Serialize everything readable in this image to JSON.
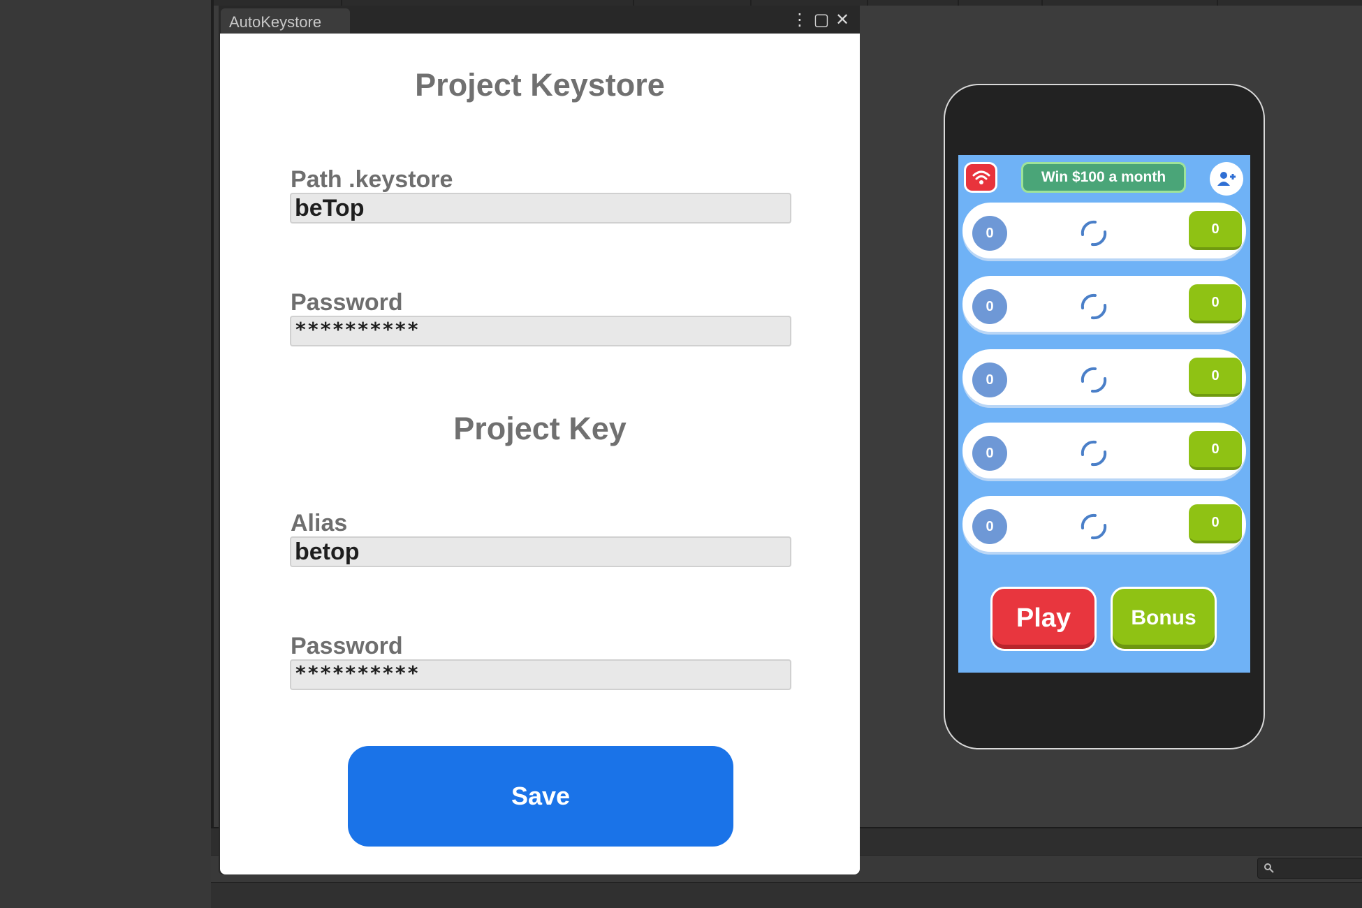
{
  "window": {
    "tab_title": "AutoKeystore",
    "controls": {
      "menu": "⋮",
      "maximize": "▢",
      "close": "✕"
    }
  },
  "keystore_section": {
    "title": "Project Keystore",
    "path_label": "Path .keystore",
    "path_value": "beTop",
    "password_label": "Password",
    "password_value": "**********"
  },
  "key_section": {
    "title": "Project Key",
    "alias_label": "Alias",
    "alias_value": "betop",
    "password_label": "Password",
    "password_value": "**********"
  },
  "save_label": "Save",
  "game_preview": {
    "banner_text": "Win $100 a month",
    "rows": [
      {
        "left": "0",
        "right": "0"
      },
      {
        "left": "0",
        "right": "0"
      },
      {
        "left": "0",
        "right": "0"
      },
      {
        "left": "0",
        "right": "0"
      },
      {
        "left": "0",
        "right": "0"
      }
    ],
    "play_label": "Play",
    "bonus_label": "Bonus"
  },
  "colors": {
    "save_button": "#1a73e8",
    "game_background": "#6fb2f6",
    "play_button": "#e8363e",
    "bonus_button": "#8fc214",
    "banner": "#4aa578"
  },
  "icons": [
    "menu-dots-icon",
    "maximize-icon",
    "close-icon",
    "wifi-icon",
    "add-user-icon",
    "loading-spinner-icon",
    "search-icon"
  ]
}
